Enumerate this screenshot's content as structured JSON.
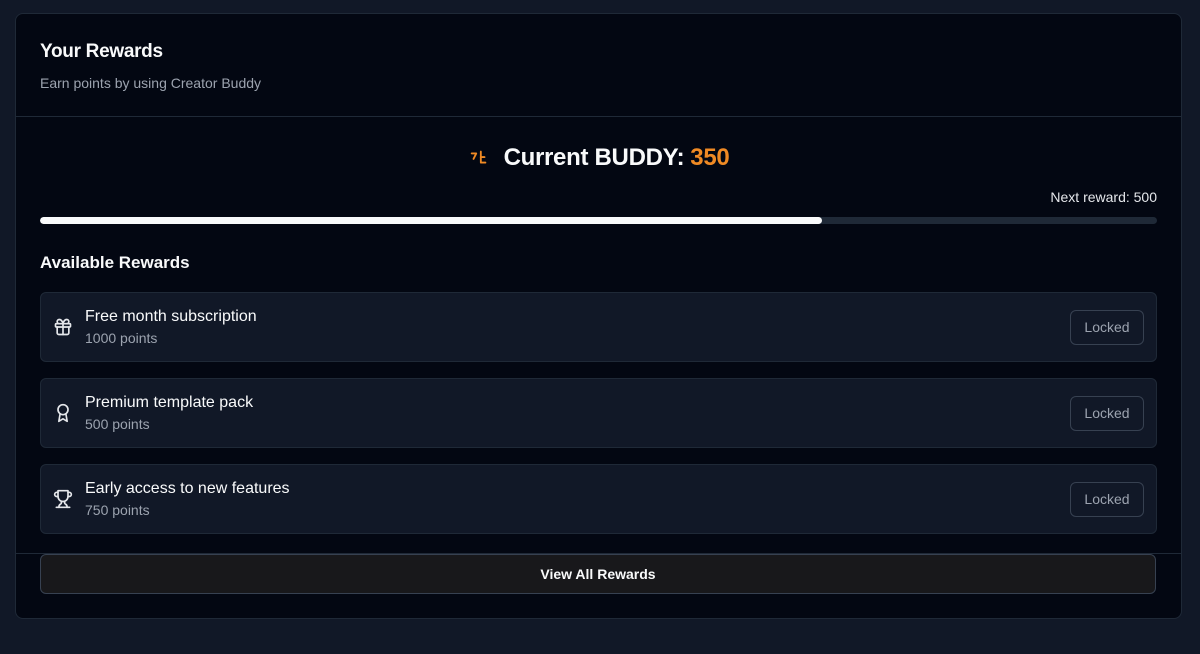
{
  "header": {
    "title": "Your Rewards",
    "subtitle": "Earn points by using Creator Buddy"
  },
  "points": {
    "label": "Current BUDDY:",
    "value": "350",
    "icon": "buddy-coin-icon",
    "accent_color": "#f08a24"
  },
  "progress": {
    "next_reward_text": "Next reward: 500",
    "fraction": 0.7
  },
  "rewards_section": {
    "title": "Available Rewards",
    "items": [
      {
        "name": "Free month subscription",
        "points": "1000 points",
        "icon": "gift-icon",
        "status": "Locked"
      },
      {
        "name": "Premium template pack",
        "points": "500 points",
        "icon": "award-icon",
        "status": "Locked"
      },
      {
        "name": "Early access to new features",
        "points": "750 points",
        "icon": "trophy-icon",
        "status": "Locked"
      }
    ]
  },
  "footer": {
    "button_label": "View All Rewards"
  }
}
